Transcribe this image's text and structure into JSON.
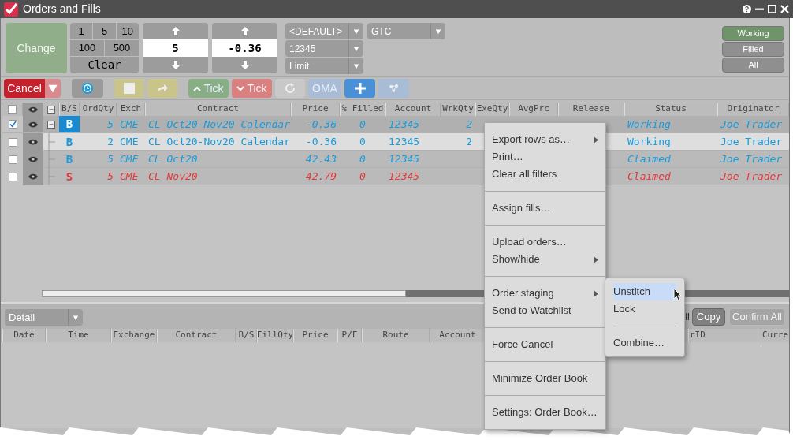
{
  "window": {
    "title": "Orders and Fills"
  },
  "order_entry": {
    "change_button": {
      "label": "Change",
      "disabled": true
    },
    "quantity_presets": [
      "1",
      "5",
      "10",
      "100",
      "500"
    ],
    "clear_button": "Clear",
    "quantity": "5",
    "price": "-0.36",
    "dropdowns": [
      {
        "value": "<DEFAULT>"
      },
      {
        "value": "12345"
      },
      {
        "value": "Limit"
      },
      {
        "value": "GTC"
      }
    ]
  },
  "filters": [
    {
      "label": "Working",
      "selected": true
    },
    {
      "label": "Filled",
      "selected": false
    },
    {
      "label": "All",
      "selected": false
    }
  ],
  "toolbar": [
    {
      "kind": "cancel",
      "label": "Cancel"
    },
    {
      "kind": "cancel_menu"
    },
    {
      "kind": "history"
    },
    {
      "kind": "stop"
    },
    {
      "kind": "redo"
    },
    {
      "kind": "tick_up",
      "label": "Tick"
    },
    {
      "kind": "tick_down",
      "label": "Tick"
    },
    {
      "kind": "refresh"
    },
    {
      "kind": "oma",
      "label": "OMA"
    },
    {
      "kind": "add"
    },
    {
      "kind": "network"
    }
  ],
  "orders": {
    "select_all_checked": false,
    "columns": [
      "B/S",
      "OrdQty",
      "Exch",
      "Contract",
      "Price",
      "% Filled",
      "Account",
      "WrkQty",
      "ExeQty",
      "AvgPrc",
      "Release",
      "Status",
      "Originator"
    ],
    "rows": [
      {
        "kind": "parent",
        "expanded": true,
        "checked": true,
        "selected": false,
        "synthetic": true,
        "bs_selected": true,
        "color": "#1a9ad8",
        "bs": "B",
        "ord_qty": "5",
        "exch": "CME",
        "contract": "CL Oct20-Nov20 Calendar",
        "price": "-0.36",
        "filled": "0",
        "account": "12345",
        "wrk_qty": "2",
        "status": "Working",
        "originator": "Joe Trader"
      },
      {
        "kind": "child",
        "checked": false,
        "selected": true,
        "synthetic": false,
        "bs_selected": false,
        "color": "#1a9ad8",
        "bs": "B",
        "ord_qty": "2",
        "exch": "CME",
        "contract": "CL Oct20-Nov20 Calendar",
        "price": "-0.36",
        "filled": "0",
        "account": "12345",
        "wrk_qty": "2",
        "status": "Working",
        "originator": "Joe Trader"
      },
      {
        "kind": "child",
        "checked": false,
        "selected": false,
        "synthetic": true,
        "bs_selected": false,
        "color": "#1a9ad8",
        "bs": "B",
        "ord_qty": "5",
        "exch": "CME",
        "contract": "CL Oct20",
        "price": "42.43",
        "filled": "0",
        "account": "12345",
        "status": "Claimed",
        "originator": "Joe Trader"
      },
      {
        "kind": "child",
        "checked": false,
        "selected": false,
        "synthetic": true,
        "bs_selected": false,
        "color": "#e03a3a",
        "bs": "S",
        "ord_qty": "5",
        "exch": "CME",
        "contract": "CL Nov20",
        "price": "42.79",
        "filled": "0",
        "account": "12345",
        "status": "Claimed",
        "originator": "Joe Trader"
      }
    ]
  },
  "fills": {
    "view": "Detail",
    "partial_button": "ll",
    "buttons": [
      {
        "label": "Copy",
        "disabled": false
      },
      {
        "label": "Confirm All",
        "disabled": true
      }
    ],
    "columns": [
      "Date",
      "Time",
      "Exchange",
      "Contract",
      "B/S",
      "FillQty",
      "Price",
      "P/F",
      "Route",
      "Account"
    ],
    "right_columns": [
      "rID",
      "Curre"
    ]
  },
  "context_menu": {
    "groups": [
      [
        {
          "label": "Export rows as…",
          "submenu": true
        },
        {
          "label": "Print…",
          "submenu": false
        },
        {
          "label": "Clear all filters",
          "submenu": false
        }
      ],
      [
        {
          "label": "Assign fills…",
          "submenu": false
        }
      ],
      [
        {
          "label": "Upload orders…",
          "submenu": false
        },
        {
          "label": "Show/hide",
          "submenu": true
        }
      ],
      [
        {
          "label": "Order staging",
          "submenu": true
        },
        {
          "label": "Send to Watchlist",
          "submenu": false
        }
      ],
      [
        {
          "label": "Force Cancel",
          "submenu": false
        }
      ],
      [
        {
          "label": "Minimize Order Book",
          "submenu": false
        }
      ],
      [
        {
          "label": "Settings: Order Book…",
          "submenu": false
        }
      ]
    ]
  },
  "submenu": {
    "groups": [
      [
        {
          "label": "Unstitch",
          "selected": true
        },
        {
          "label": "Lock",
          "selected": false
        }
      ],
      [
        {
          "label": "Combine…",
          "selected": false
        }
      ]
    ]
  }
}
